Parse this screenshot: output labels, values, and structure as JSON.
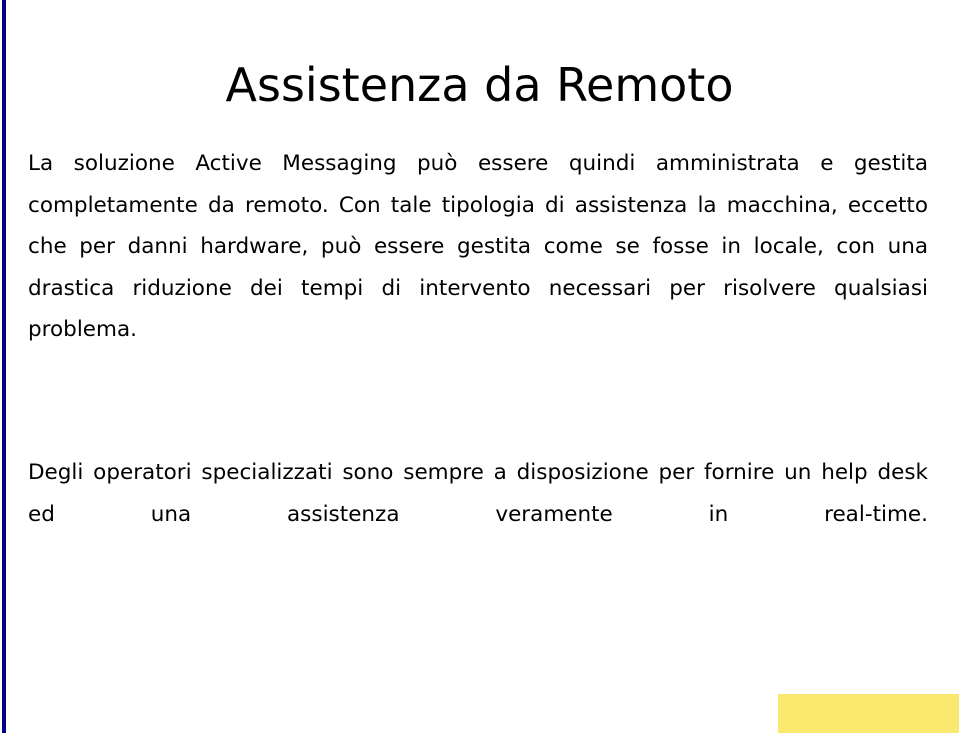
{
  "slide": {
    "title": "Assistenza da Remoto",
    "background_color": "#ffffff",
    "accent_bar_color": "#000080",
    "marker_color": "#fae96e",
    "text_color": "#000000",
    "paragraphs": [
      "La soluzione Active Messaging può essere quindi amministrata e gestita completamente da remoto. Con tale tipologia di assistenza la macchina, eccetto che per danni hardware, può essere gestita come se fosse in locale, con una drastica riduzione dei tempi di intervento necessari per risolvere qualsiasi problema.",
      "Degli operatori specializzati sono sempre a disposizione per fornire un help desk ed una assistenza veramente in real-time."
    ]
  }
}
